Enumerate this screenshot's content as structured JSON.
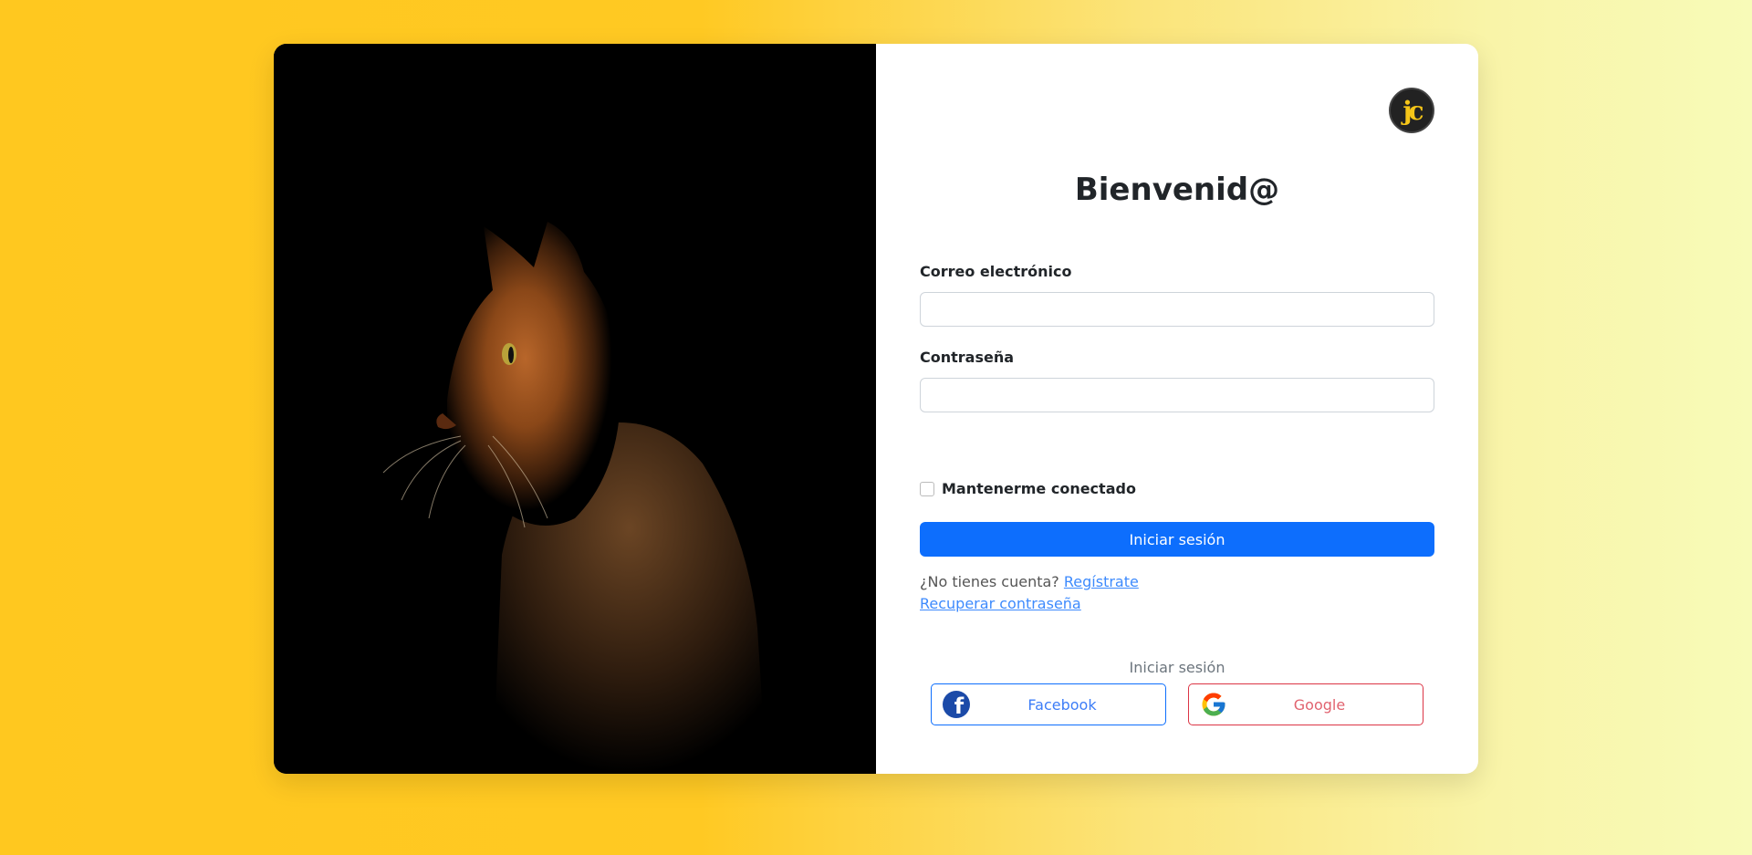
{
  "app": {
    "logo_text": "jc",
    "title": "Bienvenid@"
  },
  "form": {
    "email_label": "Correo electrónico",
    "email_value": "",
    "password_label": "Contraseña",
    "password_value": "",
    "remember_label": "Mantenerme conectado",
    "remember_checked": false,
    "submit_label": "Iniciar sesión",
    "no_account_text": "¿No tienes cuenta?",
    "register_link": "Regístrate",
    "recover_link": "Recuperar contraseña"
  },
  "social": {
    "title": "Iniciar sesión",
    "facebook_label": "Facebook",
    "google_label": "Google"
  },
  "colors": {
    "accent": "#0d6efd",
    "danger": "#dc3545",
    "background_gold": "#ffc81f"
  },
  "icons": [
    "facebook-icon",
    "google-icon",
    "logo-icon"
  ]
}
